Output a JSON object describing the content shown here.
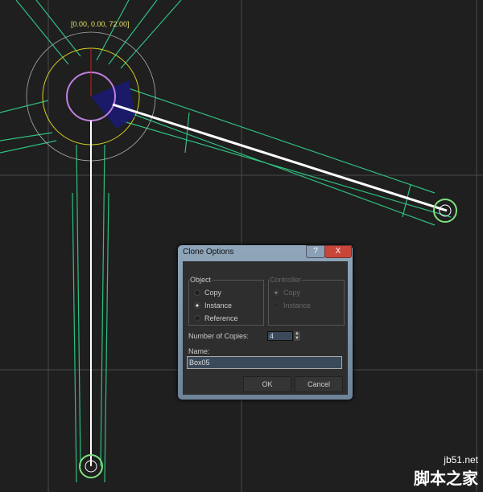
{
  "viewport": {
    "coordinate_readout": "[0.00, 0.00, 72.00]"
  },
  "dialog": {
    "title": "Clone Options",
    "help_label": "?",
    "close_label": "X",
    "object_group": {
      "label": "Object",
      "options": [
        "Copy",
        "Instance",
        "Reference"
      ],
      "selected": "Instance"
    },
    "controller_group": {
      "label": "Controller",
      "options": [
        "Copy",
        "Instance"
      ],
      "selected": "Copy",
      "disabled": true
    },
    "copies_label": "Number of Copies:",
    "copies_value": "4",
    "name_label": "Name:",
    "name_value": "Box05",
    "ok_label": "OK",
    "cancel_label": "Cancel"
  },
  "watermark": {
    "site": "jb51.net",
    "brand": "脚本之家"
  }
}
